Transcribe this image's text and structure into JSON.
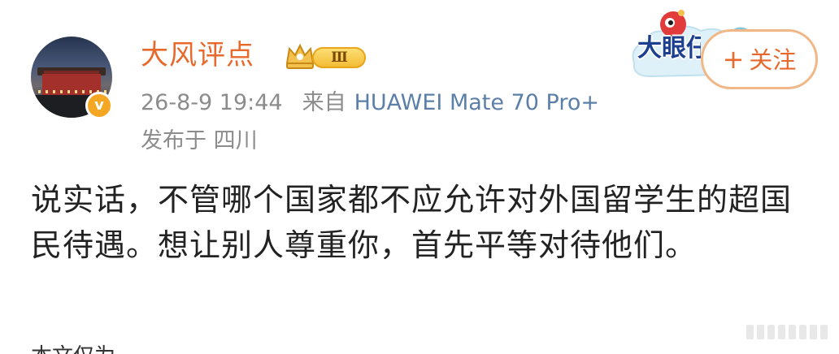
{
  "post": {
    "author": {
      "name": "大风评点",
      "level_badge": "Ⅲ",
      "avatar_icon": "avatar-image",
      "verified_badge": "v",
      "crown_icon": "crown-icon"
    },
    "timestamp": "26-8-9 19:44",
    "source_label": "来自",
    "device": "HUAWEI Mate 70 Pro+",
    "location": "发布于 四川",
    "body": "说实话，不管哪个国家都不应允许对外国留学生的超国民待遇。想让别人尊重你，首先平等对待他们。",
    "next_line_partial": "本文仅为"
  },
  "header": {
    "promo_text": "大眼仔",
    "follow_plus": "+",
    "follow_label": "关注"
  },
  "colors": {
    "accent": "#e8692c",
    "device_link": "#5b7fa9",
    "meta_gray": "#8c8c8c",
    "body_text": "#222222",
    "verified": "#f5a623"
  }
}
